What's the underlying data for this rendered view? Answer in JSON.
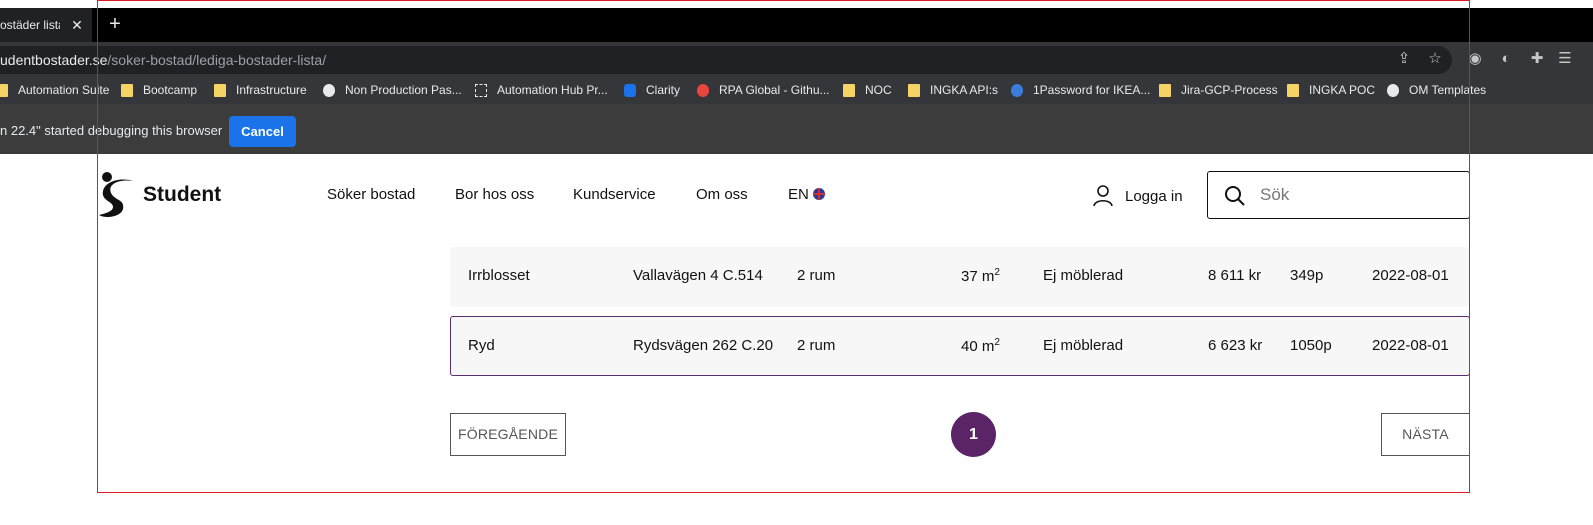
{
  "browser": {
    "tab_title": "ostäder lista |",
    "url_host": "udentbostader.se",
    "url_path": "/soker-bostad/lediga-bostader-lista/",
    "bookmarks": [
      {
        "label": "Automation Suite",
        "icon": "folder"
      },
      {
        "label": "Bootcamp",
        "icon": "folder"
      },
      {
        "label": "Infrastructure",
        "icon": "folder"
      },
      {
        "label": "Non Production Pas...",
        "icon": "globe"
      },
      {
        "label": "Automation Hub Pr...",
        "icon": "hub"
      },
      {
        "label": "Clarity",
        "icon": "c"
      },
      {
        "label": "RPA Global - Githu...",
        "icon": "rpa"
      },
      {
        "label": "NOC",
        "icon": "folder"
      },
      {
        "label": "INGKA API:s",
        "icon": "folder"
      },
      {
        "label": "1Password for IKEA...",
        "icon": "pw"
      },
      {
        "label": "Jira-GCP-Process",
        "icon": "folder"
      },
      {
        "label": "INGKA POC",
        "icon": "folder"
      },
      {
        "label": "OM Templates",
        "icon": "globe"
      }
    ],
    "infobar_message": "n 22.4\" started debugging this browser",
    "infobar_cancel": "Cancel"
  },
  "site": {
    "logo_text": "Student",
    "nav": [
      "Söker bostad",
      "Bor hos oss",
      "Kundservice",
      "Om oss",
      "EN"
    ],
    "login_label": "Logga in",
    "search_placeholder": "Sök"
  },
  "listings": [
    {
      "area": "Irrblosset",
      "address": "Vallavägen 4 C.514",
      "rooms": "2 rum",
      "size": "37 m",
      "size_unit_sup": "2",
      "furnished": "Ej möblerad",
      "rent": "8 611 kr",
      "points": "349p",
      "date": "2022-08-01",
      "highlighted": false
    },
    {
      "area": "Ryd",
      "address": "Rydsvägen 262 C.20",
      "rooms": "2 rum",
      "size": "40 m",
      "size_unit_sup": "2",
      "furnished": "Ej möblerad",
      "rent": "6 623 kr",
      "points": "1050p",
      "date": "2022-08-01",
      "highlighted": true
    }
  ],
  "pagination": {
    "prev_label": "FÖREGÅENDE",
    "current_page": "1",
    "next_label": "NÄSTA"
  },
  "colors": {
    "accent_purple": "#5a2466",
    "frame_red": "#e01b24",
    "chrome_blue": "#1a73e8"
  }
}
